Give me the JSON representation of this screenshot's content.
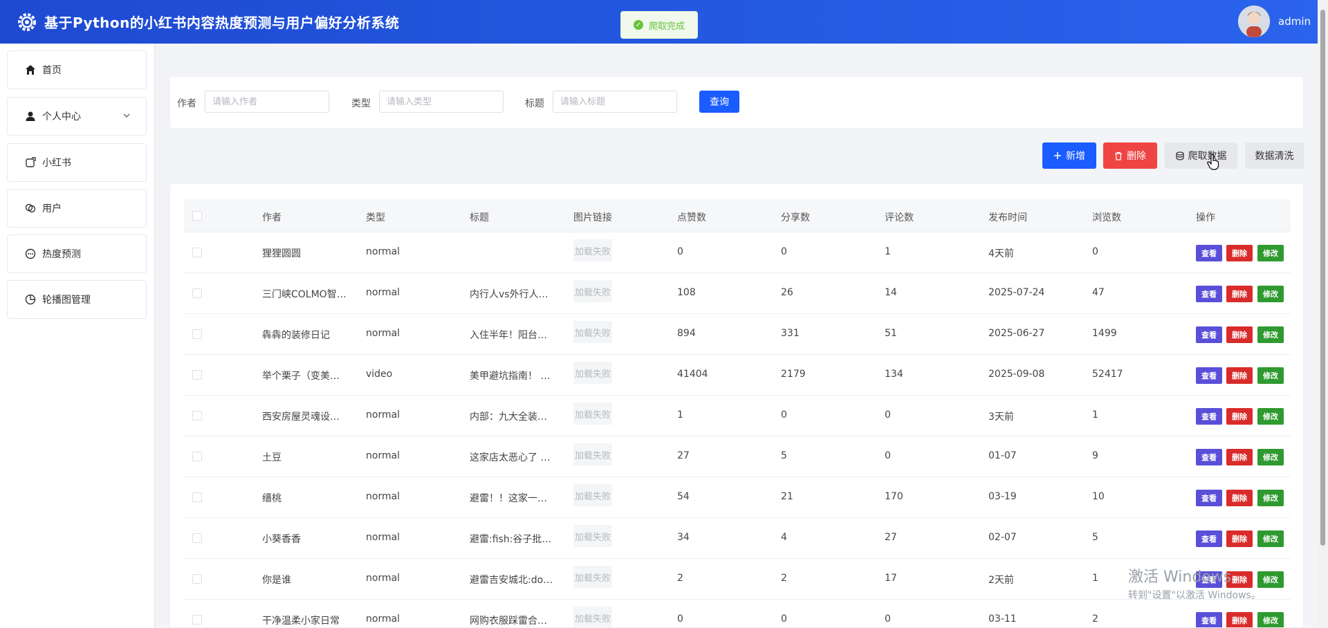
{
  "header": {
    "title": "基于Python的小红书内容热度预测与用户偏好分析系统",
    "username": "admin"
  },
  "toast": {
    "message": "爬取完成"
  },
  "sidebar": {
    "items": [
      {
        "label": "首页",
        "icon": "home-icon"
      },
      {
        "label": "个人中心",
        "icon": "user-icon"
      },
      {
        "label": "小红书",
        "icon": "note-icon"
      },
      {
        "label": "用户",
        "icon": "users-icon"
      },
      {
        "label": "热度预测",
        "icon": "chat-icon"
      },
      {
        "label": "轮播图管理",
        "icon": "pie-icon"
      }
    ]
  },
  "search": {
    "author_label": "作者",
    "author_placeholder": "请输入作者",
    "type_label": "类型",
    "type_placeholder": "请输入类型",
    "title_label": "标题",
    "title_placeholder": "请输入标题",
    "query_button": "查询"
  },
  "toolbar": {
    "add": "新增",
    "delete": "删除",
    "crawl": "爬取数据",
    "clean": "数据清洗"
  },
  "table": {
    "columns": [
      "作者",
      "类型",
      "标题",
      "图片链接",
      "点赞数",
      "分享数",
      "评论数",
      "发布时间",
      "浏览数",
      "操作"
    ],
    "image_fail_text": "加载失败",
    "actions": {
      "view": "查看",
      "delete": "删除",
      "edit": "修改"
    },
    "rows": [
      {
        "author": "狸狸圆圆",
        "type": "normal",
        "title": "",
        "likes": "0",
        "shares": "0",
        "comments": "1",
        "time": "4天前",
        "views": "0"
      },
      {
        "author": "三门峡COLMO智…",
        "type": "normal",
        "title": "内行人vs外行人…",
        "likes": "108",
        "shares": "26",
        "comments": "14",
        "time": "2025-07-24",
        "views": "47"
      },
      {
        "author": "犇犇的装修日记",
        "type": "normal",
        "title": "入住半年！阳台…",
        "likes": "894",
        "shares": "331",
        "comments": "51",
        "time": "2025-06-27",
        "views": "1499"
      },
      {
        "author": "举个栗子（变美…",
        "type": "video",
        "title": "美甲避坑指南！ …",
        "likes": "41404",
        "shares": "2179",
        "comments": "134",
        "time": "2025-09-08",
        "views": "52417"
      },
      {
        "author": "西安房屋灵魂设…",
        "type": "normal",
        "title": "内部：九大全装…",
        "likes": "1",
        "shares": "0",
        "comments": "0",
        "time": "3天前",
        "views": "1"
      },
      {
        "author": "土豆",
        "type": "normal",
        "title": "这家店太恶心了 …",
        "likes": "27",
        "shares": "5",
        "comments": "0",
        "time": "01-07",
        "views": "9"
      },
      {
        "author": "缙桃",
        "type": "normal",
        "title": "避雷！！这家一…",
        "likes": "54",
        "shares": "21",
        "comments": "170",
        "time": "03-19",
        "views": "10"
      },
      {
        "author": "小葵香香",
        "type": "normal",
        "title": "避雷:fish:谷子批…",
        "likes": "34",
        "shares": "4",
        "comments": "27",
        "time": "02-07",
        "views": "5"
      },
      {
        "author": "你是谁",
        "type": "normal",
        "title": "避雷吉安城北:do…",
        "likes": "2",
        "shares": "2",
        "comments": "17",
        "time": "2天前",
        "views": "1"
      },
      {
        "author": "干净温柔小家日常",
        "type": "normal",
        "title": "网购衣服踩雷合…",
        "likes": "0",
        "shares": "0",
        "comments": "0",
        "time": "03-11",
        "views": "2"
      }
    ]
  },
  "watermark": {
    "line1": "激活 Windows",
    "line2": "转到\"设置\"以激活 Windows。"
  }
}
